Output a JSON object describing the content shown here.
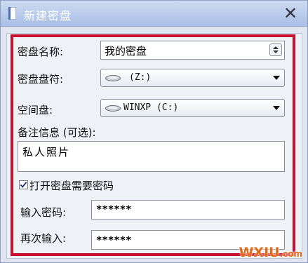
{
  "window": {
    "title": "新建密盘",
    "close_symbol": "✕"
  },
  "form": {
    "name_label": "密盘名称:",
    "name_value": "我的密盘",
    "drive_letter_label": "密盘盘符:",
    "drive_letter_value": "(Z:)",
    "space_disk_label": "空间盘:",
    "space_disk_value": "WINXP  (C:)",
    "remark_label": "备注信息 (可选):",
    "remark_value": "私人照片",
    "checkbox_label": "打开密盘需要密码",
    "checkbox_checked": true,
    "password_label": "输入密码:",
    "password_value": "******",
    "confirm_label": "再次输入:",
    "confirm_value": "******"
  },
  "icons": {
    "window_icon": "notebook-icon",
    "close": "close-icon",
    "drive": "hard-drive-icon",
    "dropdown": "chevron-down-icon",
    "spinner": "spinner-icon",
    "check": "checkmark-icon"
  },
  "colors": {
    "highlight_frame": "#c8102e",
    "titlebar": "#a9bfe5",
    "watermark": "#e06a1a"
  },
  "watermark": {
    "main": "WXIU",
    "suffix": ".com"
  }
}
